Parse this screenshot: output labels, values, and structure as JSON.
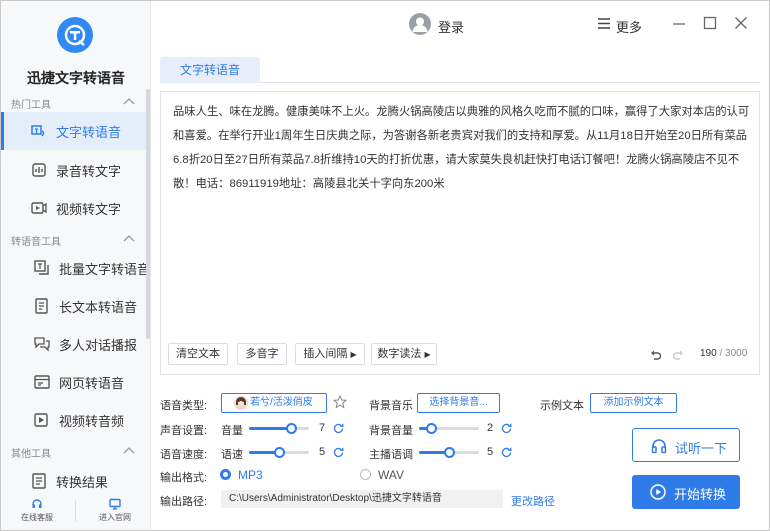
{
  "app": {
    "name": "迅捷文字转语音"
  },
  "sidebar": {
    "groups": [
      {
        "title": "热门工具"
      },
      {
        "title": "转语音工具"
      },
      {
        "title": "其他工具"
      }
    ],
    "items": [
      {
        "label": "文字转语音",
        "icon": "text-to-speech-icon",
        "active": true
      },
      {
        "label": "录音转文字",
        "icon": "recording-icon"
      },
      {
        "label": "视频转文字",
        "icon": "video-icon"
      },
      {
        "label": "批量文字转语音",
        "icon": "batch-icon"
      },
      {
        "label": "长文本转语音",
        "icon": "long-text-icon"
      },
      {
        "label": "多人对话播报",
        "icon": "dialogue-icon"
      },
      {
        "label": "网页转语音",
        "icon": "webpage-icon"
      },
      {
        "label": "视频转音频",
        "icon": "video-audio-icon"
      },
      {
        "label": "转换结果",
        "icon": "result-icon"
      }
    ],
    "bottom": {
      "service": "在线客服",
      "website": "进入官网"
    }
  },
  "topbar": {
    "login": "登录",
    "more": "更多"
  },
  "tabs": [
    {
      "label": "文字转语音"
    }
  ],
  "editor": {
    "text": "品味人生、味在龙腾。健康美味不上火。龙腾火锅高陵店以典雅的风格久吃而不腻的口味，赢得了大家对本店的认可和喜爱。在举行开业1周年生日庆典之际，为答谢各新老贵宾对我们的支持和厚爱。从11月18日开始至20日所有菜品6.8折20日至27日所有菜品7.8折维持10天的打折优惠，请大家莫失良机赶快打电话订餐吧！龙腾火锅高陵店不见不散！电话：86911919地址：高陵县北关十字向东200米",
    "buttons": {
      "clear": "清空文本",
      "polyphone": "多音字",
      "pause": "插入间隔",
      "number": "数字读法"
    },
    "count": "190",
    "total": "/ 3000"
  },
  "settings": {
    "voice_type_label": "语音类型:",
    "voice_name": "若兮/活泼俏皮",
    "bg_music_label": "背景音乐",
    "bg_music_button": "选择背景音...",
    "example_label": "示例文本",
    "example_button": "添加示例文本",
    "sound_label": "声音设置:",
    "volume_label": "音量",
    "volume": 7,
    "volume_level": 0.7,
    "bg_volume_label": "背景音量",
    "bg_volume": 2,
    "bg_volume_level": 0.2,
    "speed_label": "语音速度:",
    "rate_label": "语速",
    "rate": 5,
    "rate_level": 0.5,
    "intonation_label": "主播语调",
    "intonation": 5,
    "intonation_level": 0.5,
    "format_label": "输出格式:",
    "format_mp3": "MP3",
    "format_wav": "WAV",
    "format_selected": "MP3",
    "path_label": "输出路径:",
    "path": "C:\\Users\\Administrator\\Desktop\\迅捷文字转语音",
    "change_path": "更改路径"
  },
  "actions": {
    "listen": "试听一下",
    "start": "开始转换"
  },
  "colors": {
    "accent": "#2f7be8",
    "logo": "#2f8af5"
  }
}
